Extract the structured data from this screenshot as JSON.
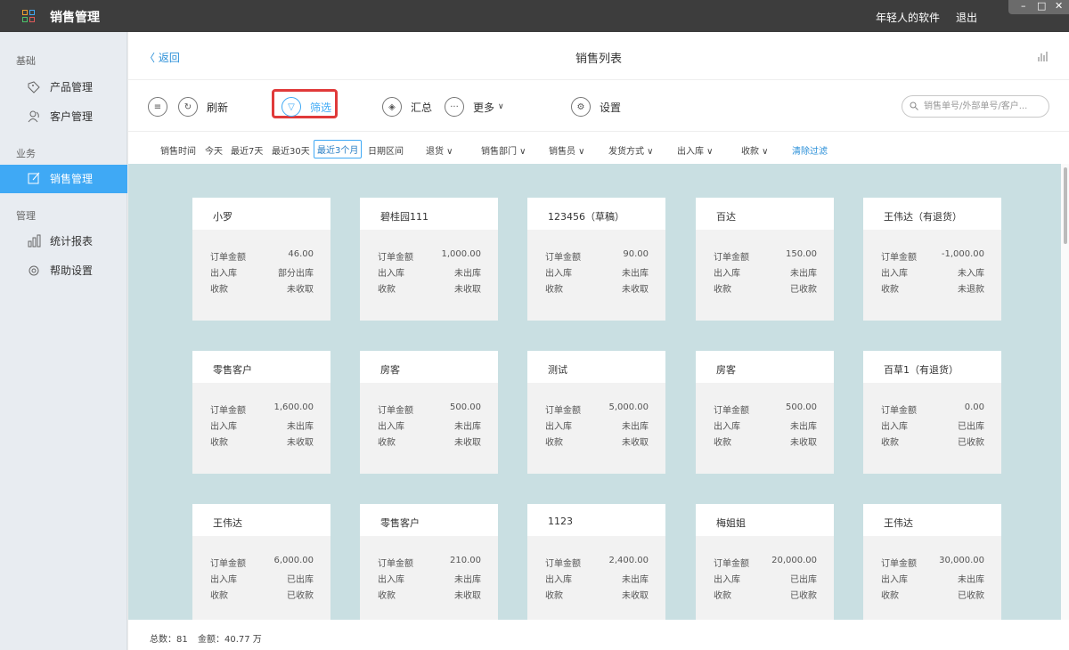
{
  "window": {
    "title": "销售管理",
    "account_label": "年轻人的软件",
    "logout_label": "退出",
    "controls": [
      "–",
      "□",
      "✕"
    ]
  },
  "sidebar": {
    "sections": [
      "基础",
      "业务",
      "管理"
    ],
    "items": [
      {
        "label": "产品管理",
        "icon": "tag-icon"
      },
      {
        "label": "客户管理",
        "icon": "users-icon"
      },
      {
        "label": "销售管理",
        "icon": "edit-icon",
        "active": true
      },
      {
        "label": "统计报表",
        "icon": "bar-chart-icon"
      },
      {
        "label": "帮助设置",
        "icon": "gear-icon"
      }
    ]
  },
  "header": {
    "back_label": "返回",
    "page_title": "销售列表"
  },
  "toolbar": {
    "refresh_label": "刷新",
    "filter_label": "筛选",
    "summary_label": "汇总",
    "more_label": "更多",
    "settings_label": "设置",
    "search_placeholder": "销售单号/外部单号/客户..."
  },
  "filters": {
    "time_label": "销售时间",
    "today": "今天",
    "last7": "最近7天",
    "last30": "最近30天",
    "last3m": "最近3个月",
    "range": "日期区间",
    "returns": "退货",
    "dept": "销售部门",
    "salesman": "销售员",
    "shipping": "发货方式",
    "stock": "出入库",
    "payment": "收款",
    "clear": "清除过滤"
  },
  "card_labels": {
    "amount": "订单金额",
    "stock": "出入库",
    "payment": "收款"
  },
  "cards": [
    {
      "name": "小罗",
      "amount": "46.00",
      "stock": "部分出库",
      "payment": "未收取"
    },
    {
      "name": "碧桂园111",
      "amount": "1,000.00",
      "stock": "未出库",
      "payment": "未收取"
    },
    {
      "name": "123456（草稿）",
      "amount": "90.00",
      "stock": "未出库",
      "payment": "未收取"
    },
    {
      "name": "百达",
      "amount": "150.00",
      "stock": "未出库",
      "payment": "已收款"
    },
    {
      "name": "王伟达（有退货）",
      "amount": "-1,000.00",
      "stock": "未入库",
      "payment": "未退款"
    },
    {
      "name": "零售客户",
      "amount": "1,600.00",
      "stock": "未出库",
      "payment": "未收取"
    },
    {
      "name": "房客",
      "amount": "500.00",
      "stock": "未出库",
      "payment": "未收取"
    },
    {
      "name": "测试",
      "amount": "5,000.00",
      "stock": "未出库",
      "payment": "未收取"
    },
    {
      "name": "房客",
      "amount": "500.00",
      "stock": "未出库",
      "payment": "未收取"
    },
    {
      "name": "百草1（有退货）",
      "amount": "0.00",
      "stock": "已出库",
      "payment": "已收款"
    },
    {
      "name": "王伟达",
      "amount": "6,000.00",
      "stock": "已出库",
      "payment": "已收款"
    },
    {
      "name": "零售客户",
      "amount": "210.00",
      "stock": "未出库",
      "payment": "未收取"
    },
    {
      "name": "1123",
      "amount": "2,400.00",
      "stock": "未出库",
      "payment": "未收取"
    },
    {
      "name": "梅姐姐",
      "amount": "20,000.00",
      "stock": "已出库",
      "payment": "已收款"
    },
    {
      "name": "王伟达",
      "amount": "30,000.00",
      "stock": "未出库",
      "payment": "已收款"
    }
  ],
  "status": {
    "total": "总数：81",
    "amount": "金额：40.77 万"
  },
  "colors": {
    "accent": "#3fa9f5",
    "titlebar": "#3d3d3d",
    "highlight": "#e03a3a",
    "content_bg": "#c9dfe2"
  }
}
